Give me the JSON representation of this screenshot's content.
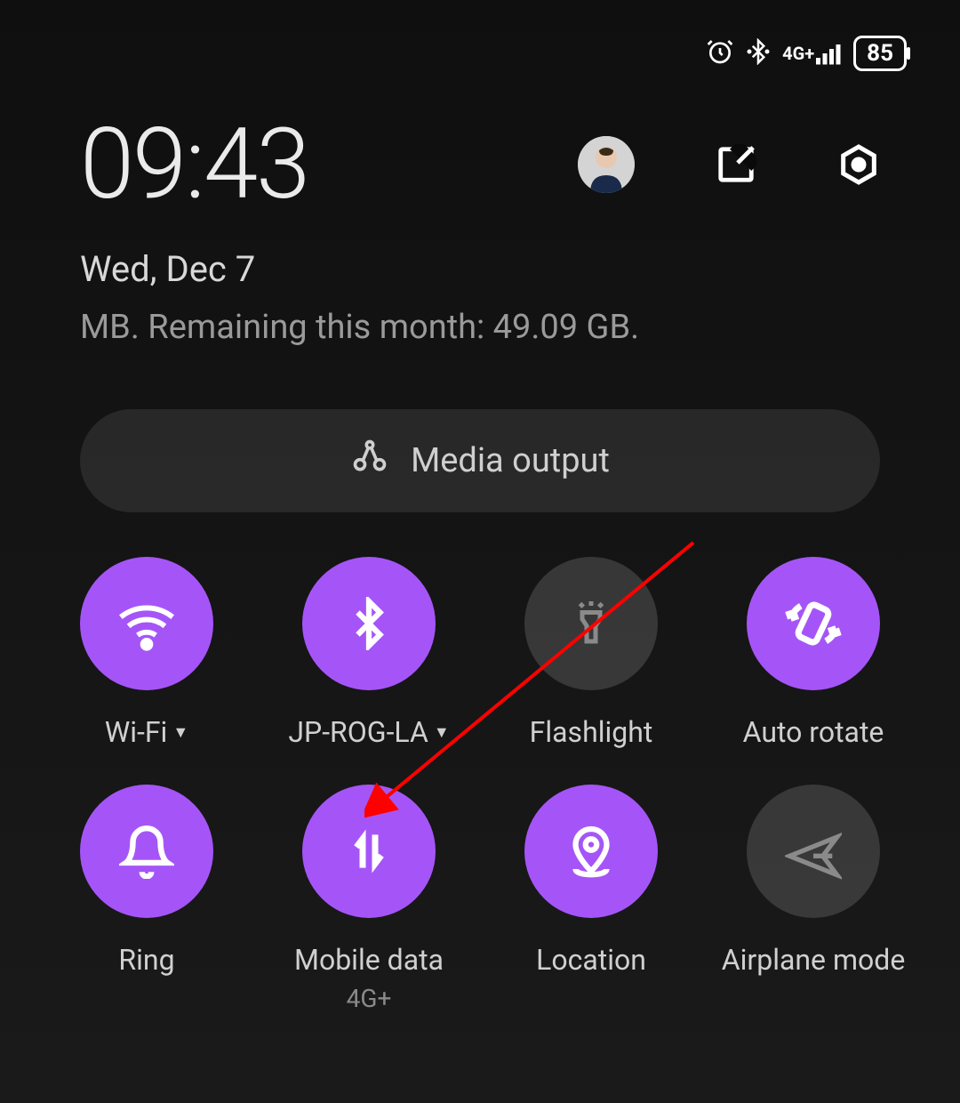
{
  "status": {
    "battery": "85",
    "network_type": "4G+"
  },
  "header": {
    "time": "09:43",
    "date": "Wed, Dec 7",
    "data_usage": "MB. Remaining this month: 49.09 GB."
  },
  "media": {
    "label": "Media output"
  },
  "toggles": [
    {
      "label": "Wi-Fi",
      "active": true,
      "icon": "wifi",
      "has_dropdown": true
    },
    {
      "label": "JP-ROG-LA",
      "active": true,
      "icon": "bluetooth",
      "has_dropdown": true
    },
    {
      "label": "Flashlight",
      "active": false,
      "icon": "flashlight",
      "has_dropdown": false
    },
    {
      "label": "Auto rotate",
      "active": true,
      "icon": "rotate",
      "has_dropdown": false
    },
    {
      "label": "Ring",
      "active": true,
      "icon": "bell",
      "has_dropdown": false
    },
    {
      "label": "Mobile data",
      "sublabel": "4G+",
      "active": true,
      "icon": "data",
      "has_dropdown": false
    },
    {
      "label": "Location",
      "active": true,
      "icon": "location",
      "has_dropdown": false
    },
    {
      "label": "Airplane mode",
      "active": false,
      "icon": "airplane",
      "has_dropdown": false
    }
  ],
  "colors": {
    "accent": "#a555f7"
  }
}
